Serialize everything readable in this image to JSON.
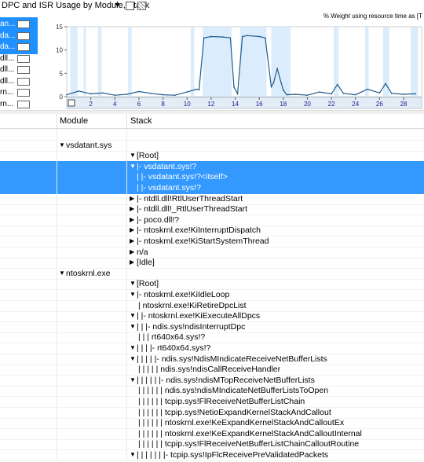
{
  "header": {
    "title": "DPC and ISR Usage by Module, Stack",
    "caret": "▼"
  },
  "legend": {
    "items": [
      {
        "label": "an...",
        "selected": true
      },
      {
        "label": "da...",
        "selected": true
      },
      {
        "label": "da...",
        "selected": true
      },
      {
        "label": "dll...",
        "selected": false
      },
      {
        "label": "dll...",
        "selected": false
      },
      {
        "label": "dll...",
        "selected": false
      },
      {
        "label": "rn...",
        "selected": false
      },
      {
        "label": "rn...",
        "selected": false
      }
    ]
  },
  "chart_data": {
    "type": "line",
    "note": "% Weight using resource time as [T",
    "ylim": [
      0,
      15
    ],
    "yticks": [
      0,
      5,
      10,
      15
    ],
    "xticks": [
      2,
      4,
      6,
      8,
      10,
      12,
      14,
      16,
      18,
      20,
      22,
      24,
      26,
      28
    ],
    "xlim": [
      0,
      29.5
    ],
    "series": [
      {
        "color": "#1f5a8c",
        "x": [
          0,
          1,
          2,
          3,
          4,
          5,
          6,
          7,
          8,
          9,
          10,
          10.8,
          11,
          11.4,
          12,
          13,
          13.6,
          13.9,
          14.2,
          14.6,
          15,
          16,
          16.5,
          17,
          17.2,
          17.5,
          17.8,
          18,
          18.3,
          19,
          20,
          21,
          22,
          22.5,
          23,
          24,
          25,
          26,
          26.5,
          27,
          28,
          29
        ],
        "y": [
          0.4,
          1.2,
          0.6,
          0.8,
          0.3,
          0.5,
          1.1,
          0.7,
          0.4,
          0.3,
          1.0,
          1.6,
          1.5,
          12.6,
          12.9,
          12.8,
          12.6,
          2.0,
          0.6,
          12.9,
          13.1,
          12.9,
          12.6,
          2.1,
          3.0,
          6.0,
          3.2,
          1.4,
          0.4,
          0.5,
          0.3,
          1.0,
          0.6,
          2.6,
          0.7,
          0.4,
          1.6,
          0.8,
          2.8,
          0.7,
          0.5,
          0.6
        ]
      }
    ]
  },
  "columns": {
    "module": "Module",
    "stack": "Stack"
  },
  "rows": [
    {
      "module": "",
      "stack": "",
      "mod_arrow": "",
      "stack_arrow": "",
      "indent": 0,
      "selected": false
    },
    {
      "module": "vsdatant.sys",
      "stack": "",
      "mod_arrow": "▼",
      "stack_arrow": "",
      "indent": 0,
      "selected": false
    },
    {
      "module": "",
      "stack": "[Root]",
      "mod_arrow": "",
      "stack_arrow": "▼",
      "indent": 0,
      "selected": false
    },
    {
      "module": "",
      "stack": "|- vsdatant.sys!?",
      "mod_arrow": "",
      "stack_arrow": "▼",
      "indent": 0,
      "selected": true
    },
    {
      "module": "",
      "stack": "|    |- vsdatant.sys!?<itself>",
      "mod_arrow": "",
      "stack_arrow": "",
      "indent": 0,
      "selected": true
    },
    {
      "module": "",
      "stack": "|    |- vsdatant.sys!?",
      "mod_arrow": "",
      "stack_arrow": "",
      "indent": 0,
      "selected": true
    },
    {
      "module": "",
      "stack": "|- ntdll.dll!RtlUserThreadStart",
      "mod_arrow": "",
      "stack_arrow": "▶",
      "indent": 0,
      "selected": false
    },
    {
      "module": "",
      "stack": "|- ntdll.dll!_RtlUserThreadStart",
      "mod_arrow": "",
      "stack_arrow": "▶",
      "indent": 0,
      "selected": false
    },
    {
      "module": "",
      "stack": "|- poco.dll!?",
      "mod_arrow": "",
      "stack_arrow": "▶",
      "indent": 0,
      "selected": false
    },
    {
      "module": "",
      "stack": "|- ntoskrnl.exe!KiInterruptDispatch",
      "mod_arrow": "",
      "stack_arrow": "▶",
      "indent": 0,
      "selected": false
    },
    {
      "module": "",
      "stack": "|- ntoskrnl.exe!KiStartSystemThread",
      "mod_arrow": "",
      "stack_arrow": "▶",
      "indent": 0,
      "selected": false
    },
    {
      "module": "",
      "stack": "n/a",
      "mod_arrow": "",
      "stack_arrow": "▶",
      "indent": 0,
      "selected": false
    },
    {
      "module": "",
      "stack": "[Idle]",
      "mod_arrow": "",
      "stack_arrow": "▶",
      "indent": 0,
      "selected": false
    },
    {
      "module": "ntoskrnl.exe",
      "stack": "",
      "mod_arrow": "▼",
      "stack_arrow": "",
      "indent": 0,
      "selected": false
    },
    {
      "module": "",
      "stack": "[Root]",
      "mod_arrow": "",
      "stack_arrow": "▼",
      "indent": 0,
      "selected": false
    },
    {
      "module": "",
      "stack": "|- ntoskrnl.exe!KiIdleLoop",
      "mod_arrow": "",
      "stack_arrow": "▼",
      "indent": 0,
      "selected": false
    },
    {
      "module": "",
      "stack": "|   ntoskrnl.exe!KiRetireDpcList",
      "mod_arrow": "",
      "stack_arrow": "",
      "indent": 1,
      "selected": false
    },
    {
      "module": "",
      "stack": "|   |- ntoskrnl.exe!KiExecuteAllDpcs",
      "mod_arrow": "",
      "stack_arrow": "▼",
      "indent": 0,
      "selected": false
    },
    {
      "module": "",
      "stack": "|   |   |- ndis.sys!ndisInterruptDpc",
      "mod_arrow": "",
      "stack_arrow": "▼",
      "indent": 0,
      "selected": false
    },
    {
      "module": "",
      "stack": "|   |   |   rt640x64.sys!?",
      "mod_arrow": "",
      "stack_arrow": "",
      "indent": 1,
      "selected": false
    },
    {
      "module": "",
      "stack": "|   |   |   |- rt640x64.sys!?",
      "mod_arrow": "",
      "stack_arrow": "▼",
      "indent": 0,
      "selected": false
    },
    {
      "module": "",
      "stack": "|   |   |   |   |- ndis.sys!NdisMIndicateReceiveNetBufferLists",
      "mod_arrow": "",
      "stack_arrow": "▼",
      "indent": 0,
      "selected": false
    },
    {
      "module": "",
      "stack": "|   |   |   |   |   ndis.sys!ndisCallReceiveHandler",
      "mod_arrow": "",
      "stack_arrow": "",
      "indent": 1,
      "selected": false
    },
    {
      "module": "",
      "stack": "|   |   |   |   |   |- ndis.sys!ndisMTopReceiveNetBufferLists",
      "mod_arrow": "",
      "stack_arrow": "▼",
      "indent": 0,
      "selected": false
    },
    {
      "module": "",
      "stack": "|   |   |   |   |   |   ndis.sys!ndisMIndicateNetBufferListsToOpen",
      "mod_arrow": "",
      "stack_arrow": "",
      "indent": 1,
      "selected": false
    },
    {
      "module": "",
      "stack": "|   |   |   |   |   |   tcpip.sys!FlReceiveNetBufferListChain",
      "mod_arrow": "",
      "stack_arrow": "",
      "indent": 1,
      "selected": false
    },
    {
      "module": "",
      "stack": "|   |   |   |   |   |   tcpip.sys!NetioExpandKernelStackAndCallout",
      "mod_arrow": "",
      "stack_arrow": "",
      "indent": 1,
      "selected": false
    },
    {
      "module": "",
      "stack": "|   |   |   |   |   |   ntoskrnl.exe!KeExpandKernelStackAndCalloutEx",
      "mod_arrow": "",
      "stack_arrow": "",
      "indent": 1,
      "selected": false
    },
    {
      "module": "",
      "stack": "|   |   |   |   |   |   ntoskrnl.exe!KeExpandKernelStackAndCalloutInternal",
      "mod_arrow": "",
      "stack_arrow": "",
      "indent": 1,
      "selected": false
    },
    {
      "module": "",
      "stack": "|   |   |   |   |   |   tcpip.sys!FlReceiveNetBufferListChainCalloutRoutine",
      "mod_arrow": "",
      "stack_arrow": "",
      "indent": 1,
      "selected": false
    },
    {
      "module": "",
      "stack": "|   |   |   |   |   |   |- tcpip.sys!IpFlcReceivePreValidatedPackets",
      "mod_arrow": "",
      "stack_arrow": "▼",
      "indent": 0,
      "selected": false
    }
  ]
}
